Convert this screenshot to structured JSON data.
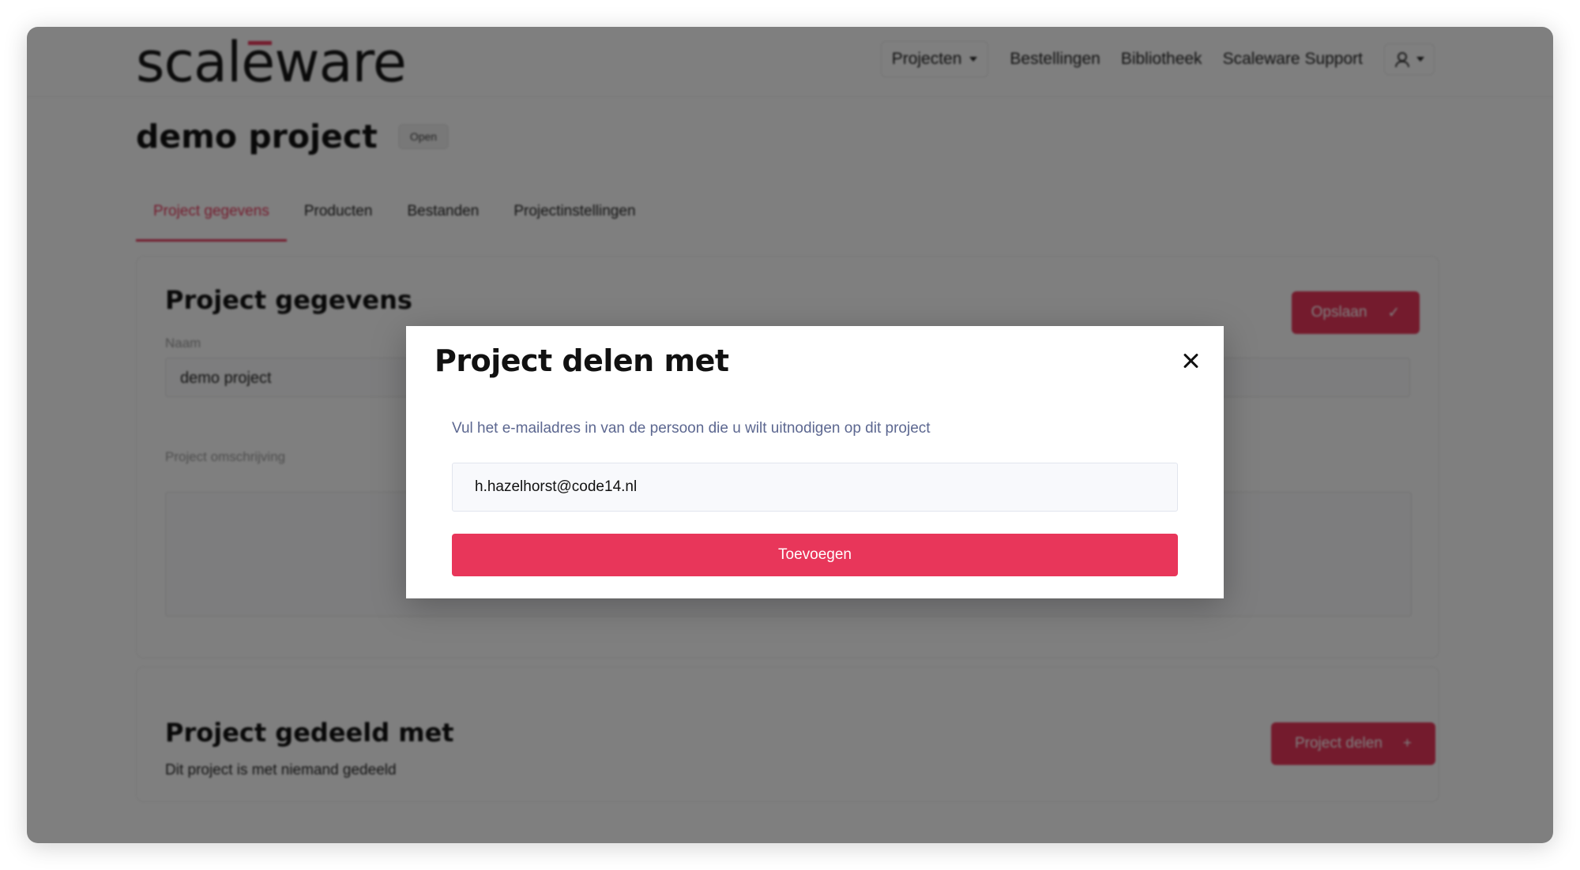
{
  "app": {
    "logo_text": "scaleware"
  },
  "header": {
    "nav": [
      {
        "label": "Projecten"
      },
      {
        "label": "Bestellingen"
      },
      {
        "label": "Bibliotheek"
      },
      {
        "label": "Scaleware Support"
      }
    ],
    "user_menu_icon": "user-icon"
  },
  "project": {
    "title": "demo project",
    "status": "Open",
    "tabs": [
      {
        "label": "Project gegevens",
        "active": true
      },
      {
        "label": "Producten"
      },
      {
        "label": "Bestanden"
      },
      {
        "label": "Projectinstellingen"
      }
    ]
  },
  "details_card": {
    "title": "Project gegevens",
    "save_label": "Opslaan",
    "name_label": "Naam",
    "name_value": "demo project",
    "description_label": "Project omschrijving"
  },
  "shared_card": {
    "title": "Project gedeeld met",
    "empty_text": "Dit project is met niemand gedeeld",
    "share_label": "Project delen"
  },
  "modal": {
    "title": "Project delen met",
    "hint": "Vul het e-mailadres in van de persoon die u wilt uitnodigen op dit project",
    "email_value": "h.hazelhorst@code14.nl",
    "submit_label": "Toevoegen"
  },
  "colors": {
    "accent": "#e8365a",
    "hint_text": "#5c6790"
  }
}
